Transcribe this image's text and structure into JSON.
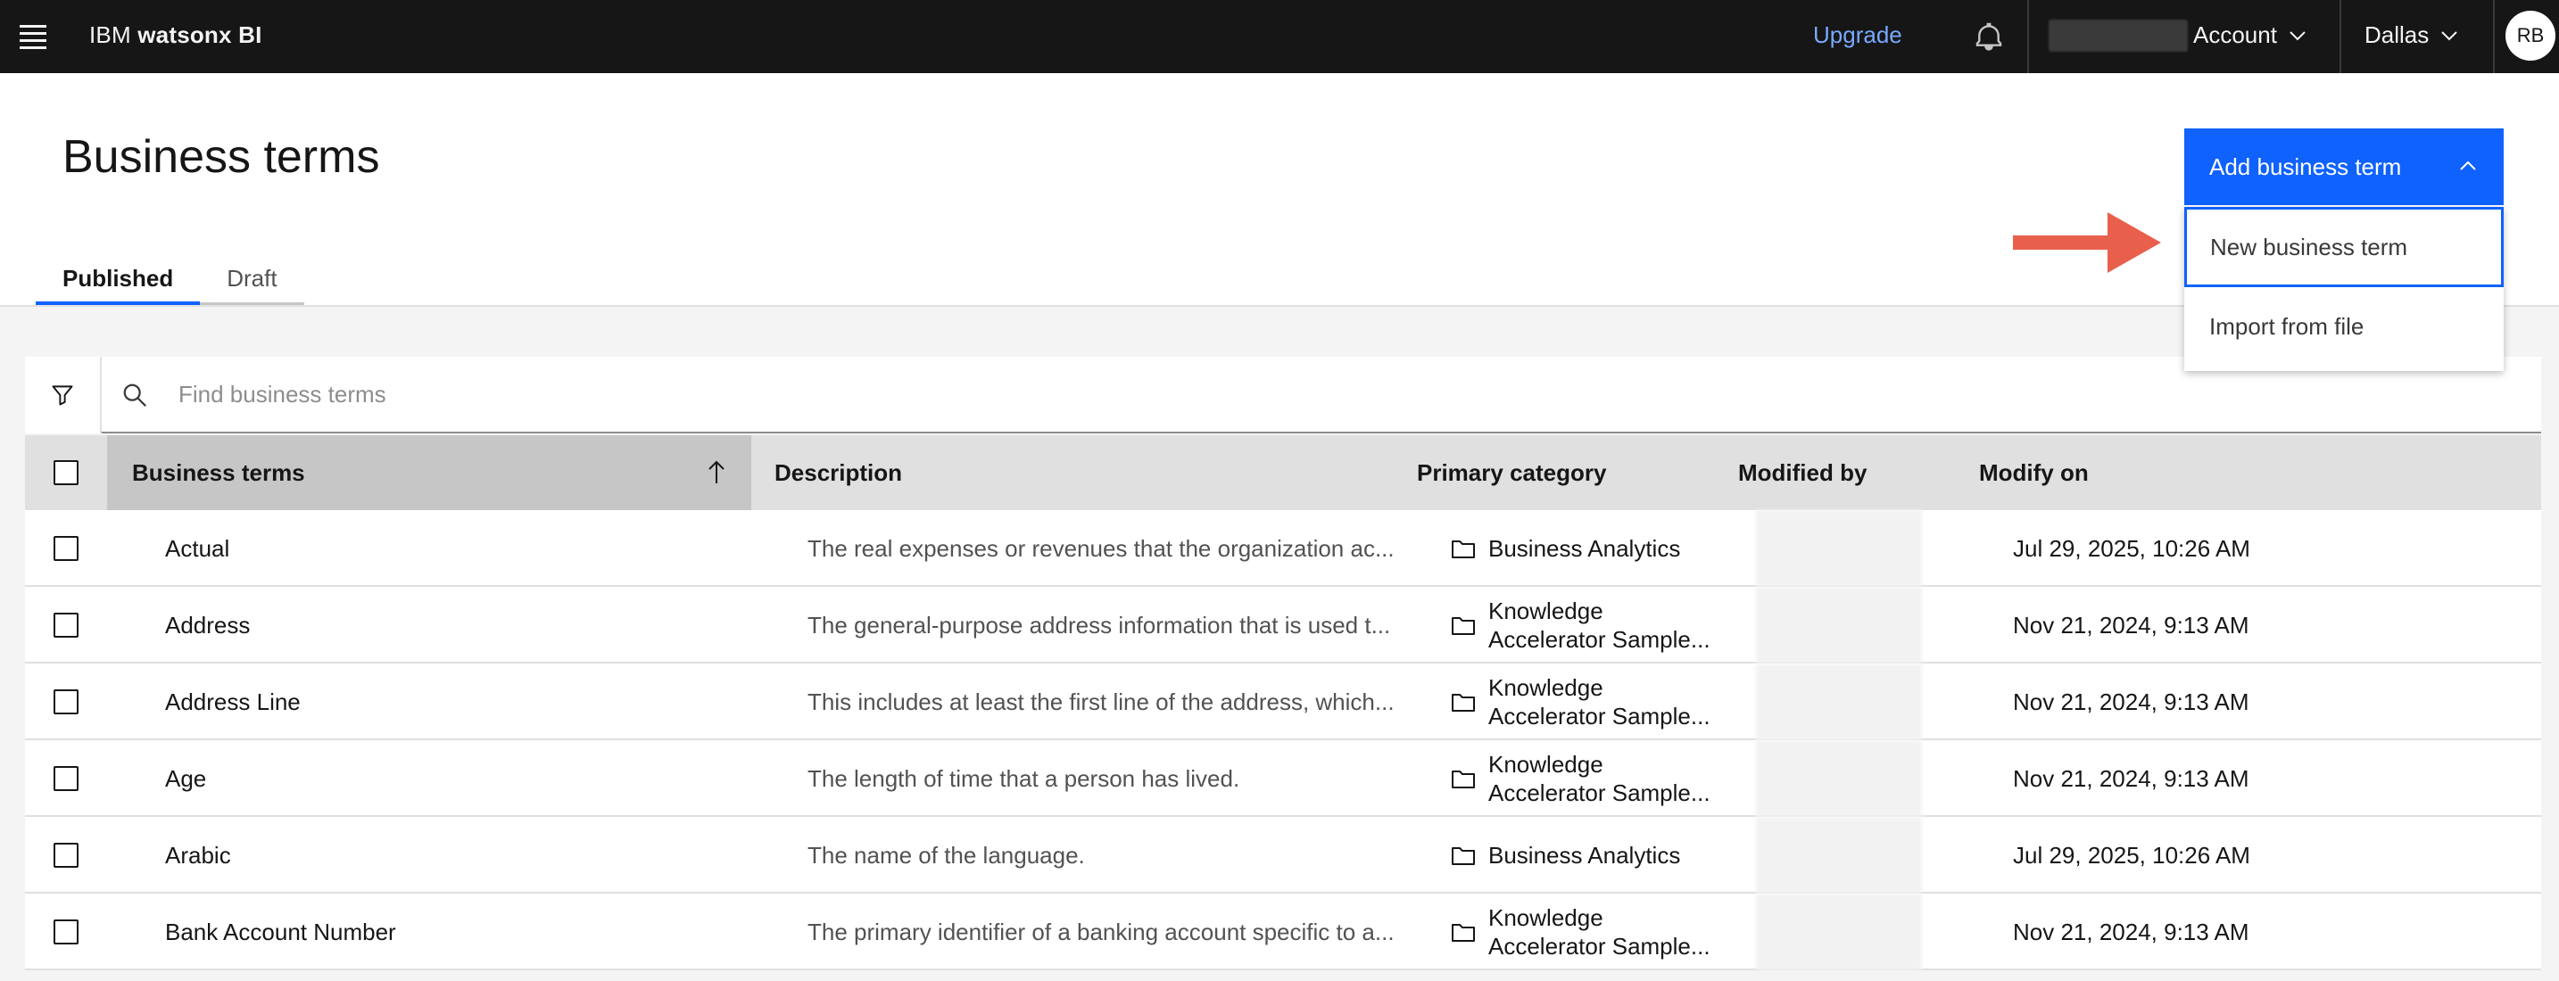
{
  "header": {
    "brand_prefix": "IBM ",
    "brand_name": "watsonx BI",
    "upgrade_label": "Upgrade",
    "account_label": "Account",
    "region_label": "Dallas",
    "avatar_initials": "RB"
  },
  "page": {
    "title": "Business terms",
    "tabs": [
      {
        "label": "Published",
        "active": true
      },
      {
        "label": "Draft",
        "active": false
      }
    ]
  },
  "add_button": {
    "label": "Add business term",
    "menu": [
      {
        "label": "New business term",
        "focused": true
      },
      {
        "label": "Import from file",
        "focused": false
      }
    ]
  },
  "search": {
    "placeholder": "Find business terms"
  },
  "table": {
    "columns": [
      "Business terms",
      "Description",
      "Primary category",
      "Modified by",
      "Modify on"
    ],
    "rows": [
      {
        "term": "Actual",
        "description": "The real expenses or revenues that the organization ac...",
        "category_l1": "Business Analytics",
        "category_l2": "",
        "modified_on": "Jul 29, 2025, 10:26 AM"
      },
      {
        "term": "Address",
        "description": "The general-purpose address information that is used t...",
        "category_l1": "Knowledge",
        "category_l2": "Accelerator Sample...",
        "modified_on": "Nov 21, 2024, 9:13 AM"
      },
      {
        "term": "Address Line",
        "description": "This includes at least the first line of the address, which...",
        "category_l1": "Knowledge",
        "category_l2": "Accelerator Sample...",
        "modified_on": "Nov 21, 2024, 9:13 AM"
      },
      {
        "term": "Age",
        "description": "The length of time that a person has lived.",
        "category_l1": "Knowledge",
        "category_l2": "Accelerator Sample...",
        "modified_on": "Nov 21, 2024, 9:13 AM"
      },
      {
        "term": "Arabic",
        "description": "The name of the language.",
        "category_l1": "Business Analytics",
        "category_l2": "",
        "modified_on": "Jul 29, 2025, 10:26 AM"
      },
      {
        "term": "Bank Account Number",
        "description": "The primary identifier of a banking account specific to a...",
        "category_l1": "Knowledge",
        "category_l2": "Accelerator Sample...",
        "modified_on": "Nov 21, 2024, 9:13 AM"
      }
    ]
  },
  "colors": {
    "primary": "#0f62fe",
    "annotation_arrow": "#e8604c",
    "topbar": "#161616"
  }
}
